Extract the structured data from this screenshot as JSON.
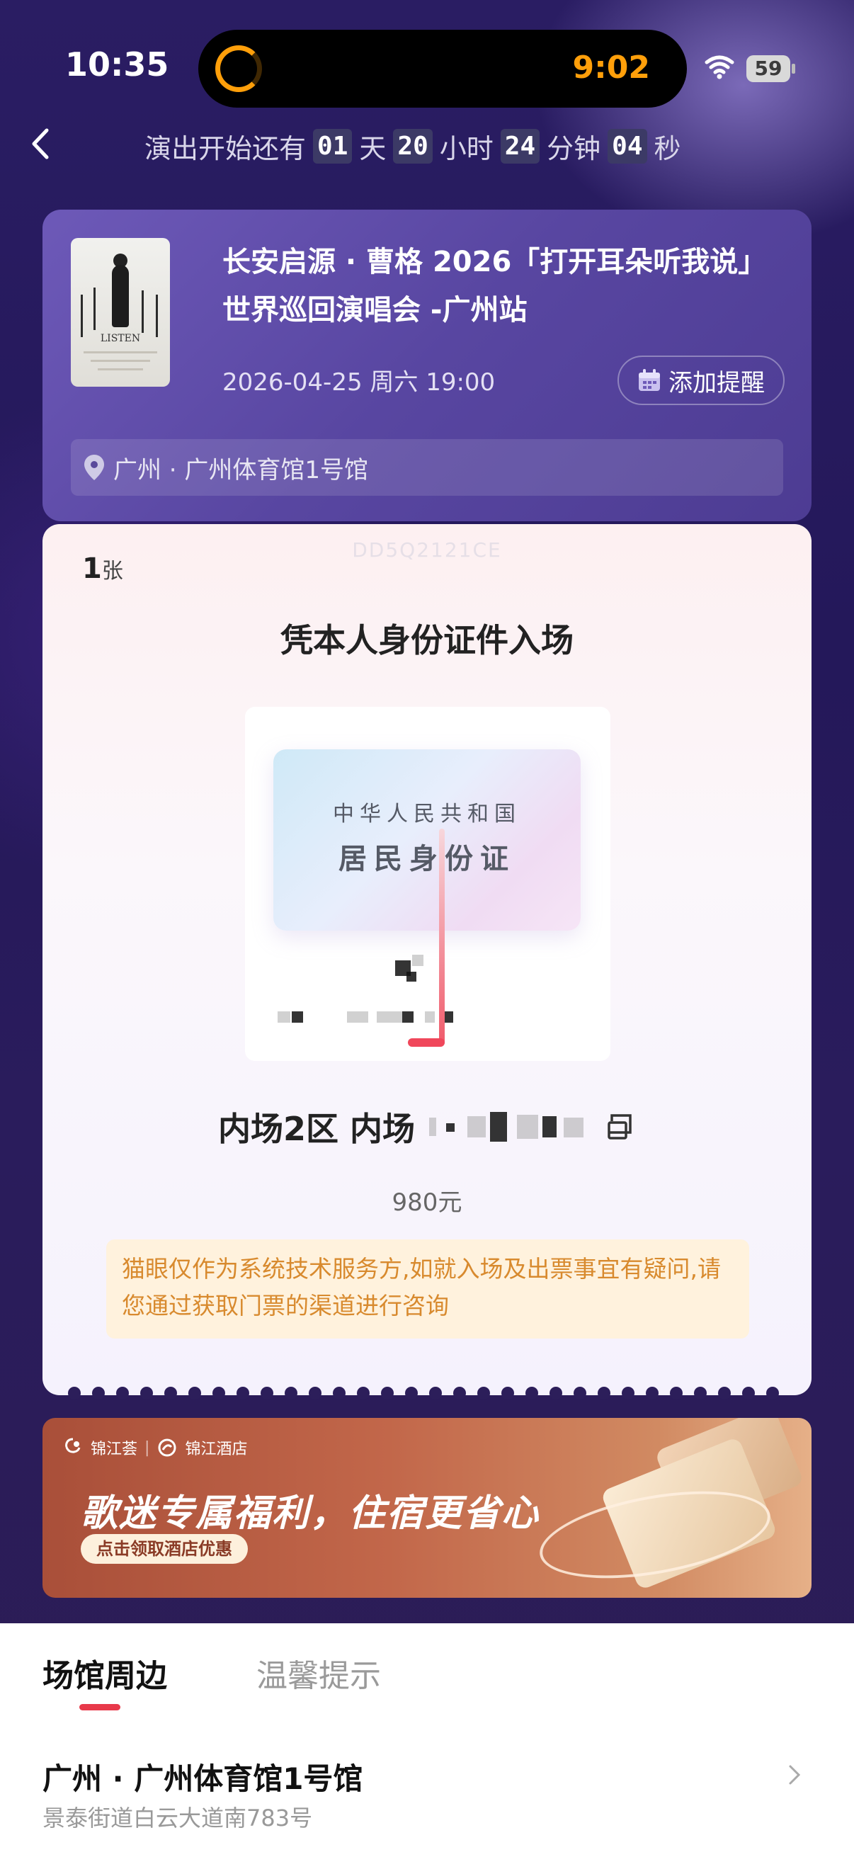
{
  "status_bar": {
    "time": "10:35",
    "activity_time": "9:02",
    "battery": "59"
  },
  "countdown": {
    "prefix": "演出开始还有",
    "days": "01",
    "days_unit": "天",
    "hours": "20",
    "hours_unit": "小时",
    "minutes": "24",
    "minutes_unit": "分钟",
    "seconds": "04",
    "seconds_unit": "秒"
  },
  "event": {
    "poster_text": "LISTEN",
    "title": "长安启源 · 曹格 2026「打开耳朵听我说」世界巡回演唱会 -广州站",
    "datetime": "2026-04-25 周六 19:00",
    "remind_label": "添加提醒",
    "venue": "广州 · 广州体育馆1号馆"
  },
  "ticket": {
    "count": "1",
    "count_unit": "张",
    "code": "DD5Q2121CE",
    "entry_title": "凭本人身份证件入场",
    "id_card_line1": "中华人民共和国",
    "id_card_line2": "居民身份证",
    "seat": "内场2区 内场",
    "price": "980元",
    "notice": "猫眼仅作为系统技术服务方,如就入场及出票事宜有疑问,请您通过获取门票的渠道进行咨询"
  },
  "banner": {
    "brand1": "锦江荟",
    "brand2": "锦江酒店",
    "headline": "歌迷专属福利，住宿更省心",
    "cta": "点击领取酒店优惠"
  },
  "sheet": {
    "tabs": [
      {
        "label": "场馆周边",
        "active": true
      },
      {
        "label": "温馨提示",
        "active": false
      }
    ],
    "venue_name": "广州 · 广州体育馆1号馆",
    "venue_address": "景泰街道白云大道南783号"
  },
  "colors": {
    "accent": "#e8394a",
    "activity": "#ff9f0a",
    "notice_text": "#d88a2e"
  }
}
